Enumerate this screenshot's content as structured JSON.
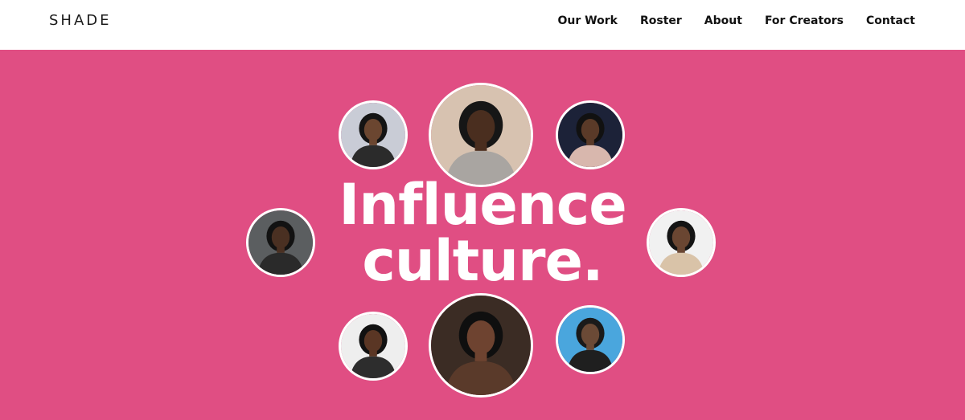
{
  "brand": {
    "logo_text": "SHADE"
  },
  "nav": [
    {
      "label": "Our Work"
    },
    {
      "label": "Roster"
    },
    {
      "label": "About"
    },
    {
      "label": "For Creators"
    },
    {
      "label": "Contact"
    }
  ],
  "hero": {
    "headline_line1": "Influence",
    "headline_line2": "culture.",
    "background_color": "#e04e83",
    "text_color": "#ffffff"
  },
  "avatars": [
    {
      "name": "creator-portrait-1",
      "bg": "#c9ccd6",
      "skin": "#6b4630",
      "hair": "#141414",
      "shirt": "#2b2b2b"
    },
    {
      "name": "creator-portrait-2",
      "bg": "#d7c2b0",
      "skin": "#4a2e1f",
      "hair": "#161616",
      "shirt": "#a9a5a1"
    },
    {
      "name": "creator-portrait-3",
      "bg": "#1c2238",
      "skin": "#5a3a28",
      "hair": "#111111",
      "shirt": "#d8b7ad"
    },
    {
      "name": "creator-portrait-4",
      "bg": "#5b5e60",
      "skin": "#4a3022",
      "hair": "#121212",
      "shirt": "#2a2a2a"
    },
    {
      "name": "creator-portrait-5",
      "bg": "#f1f1f1",
      "skin": "#6a4632",
      "hair": "#141414",
      "shirt": "#d9c3a8"
    },
    {
      "name": "creator-portrait-6",
      "bg": "#eeeeee",
      "skin": "#5a3624",
      "hair": "#111111",
      "shirt": "#2d2d2d"
    },
    {
      "name": "creator-portrait-7",
      "bg": "#3b2c24",
      "skin": "#6e4330",
      "hair": "#0f0f0f",
      "shirt": "#5a3a2a"
    },
    {
      "name": "creator-portrait-8",
      "bg": "#4aa6dd",
      "skin": "#6b4a36",
      "hair": "#1a1a1a",
      "shirt": "#1f1f1f"
    }
  ]
}
